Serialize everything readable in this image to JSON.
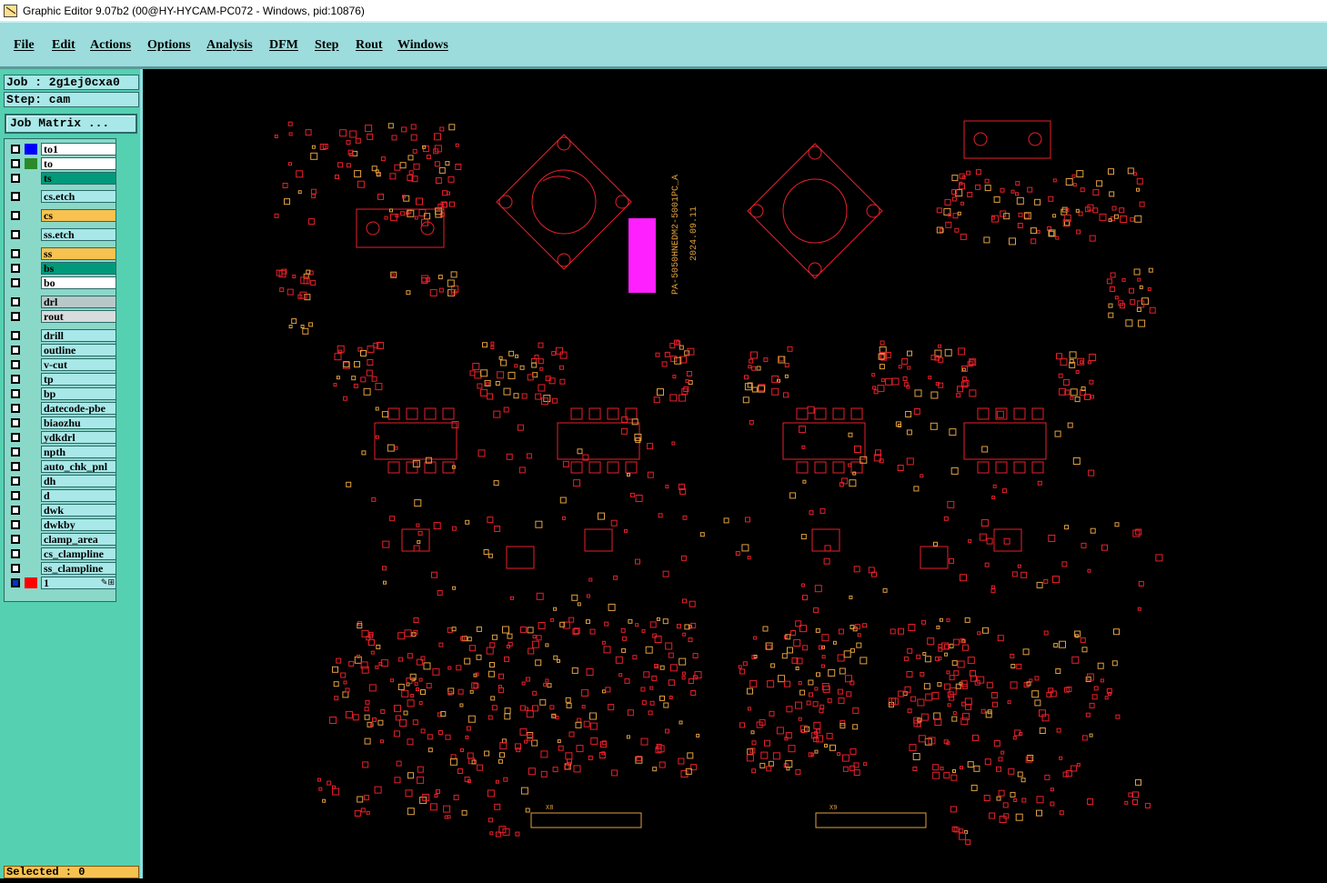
{
  "window": {
    "title": "Graphic Editor 9.07b2 (00@HY-HYCAM-PC072 - Windows, pid:10876)"
  },
  "menu": [
    "File",
    "Edit",
    "Actions",
    "Options",
    "Analysis",
    "DFM",
    "Step",
    "Rout",
    "Windows"
  ],
  "job": {
    "job_label": "Job : 2g1ej0cxa0",
    "step_label": "Step: cam",
    "matrix_button": "Job Matrix ..."
  },
  "layers": [
    {
      "name": "to1",
      "color": "#ffffff",
      "swatch": "#0000ff"
    },
    {
      "name": "to",
      "color": "#ffffff",
      "swatch": "#2a8a2a"
    },
    {
      "name": "ts",
      "color": "#009a7a",
      "swatch": ""
    },
    {
      "name": "cs.etch",
      "color": "#a8e8e8",
      "swatch": ""
    },
    {
      "name": "cs",
      "color": "#f7c24f",
      "swatch": ""
    },
    {
      "name": "ss.etch",
      "color": "#a8e8e8",
      "swatch": ""
    },
    {
      "name": "ss",
      "color": "#f7c24f",
      "swatch": ""
    },
    {
      "name": "bs",
      "color": "#009a7a",
      "swatch": ""
    },
    {
      "name": "bo",
      "color": "#ffffff",
      "swatch": ""
    },
    {
      "name": "drl",
      "color": "#b8c8c8",
      "swatch": ""
    },
    {
      "name": "rout",
      "color": "#d8dcdc",
      "swatch": ""
    },
    {
      "name": "drill",
      "color": "#a8e8e8",
      "swatch": ""
    },
    {
      "name": "outline",
      "color": "#a8e8e8",
      "swatch": ""
    },
    {
      "name": "v-cut",
      "color": "#a8e8e8",
      "swatch": ""
    },
    {
      "name": "tp",
      "color": "#a8e8e8",
      "swatch": ""
    },
    {
      "name": "bp",
      "color": "#a8e8e8",
      "swatch": ""
    },
    {
      "name": "datecode-pbe",
      "color": "#a8e8e8",
      "swatch": ""
    },
    {
      "name": "biaozhu",
      "color": "#a8e8e8",
      "swatch": ""
    },
    {
      "name": "ydkdrl",
      "color": "#a8e8e8",
      "swatch": ""
    },
    {
      "name": "npth",
      "color": "#a8e8e8",
      "swatch": ""
    },
    {
      "name": "auto_chk_pnl",
      "color": "#a8e8e8",
      "swatch": ""
    },
    {
      "name": "dh",
      "color": "#a8e8e8",
      "swatch": ""
    },
    {
      "name": "d",
      "color": "#a8e8e8",
      "swatch": ""
    },
    {
      "name": "dwk",
      "color": "#a8e8e8",
      "swatch": ""
    },
    {
      "name": "dwkby",
      "color": "#a8e8e8",
      "swatch": ""
    },
    {
      "name": "clamp_area",
      "color": "#a8e8e8",
      "swatch": ""
    },
    {
      "name": "cs_clampline",
      "color": "#a8e8e8",
      "swatch": ""
    },
    {
      "name": "ss_clampline",
      "color": "#a8e8e8",
      "swatch": ""
    },
    {
      "name": "1",
      "color": "#a8e8e8",
      "swatch": "#ff0000",
      "checked": true
    }
  ],
  "status": {
    "selected_label": "Selected : 0"
  },
  "canvas": {
    "board_text": "PA-5050HNEDM2-5001PC_A",
    "date_text": "2024.09.11",
    "label_left": "X8",
    "label_right": "X9",
    "colors": {
      "outline": "#e8202a",
      "pad": "#e0a040",
      "highlight": "#ff20ff",
      "background": "#000000"
    }
  }
}
